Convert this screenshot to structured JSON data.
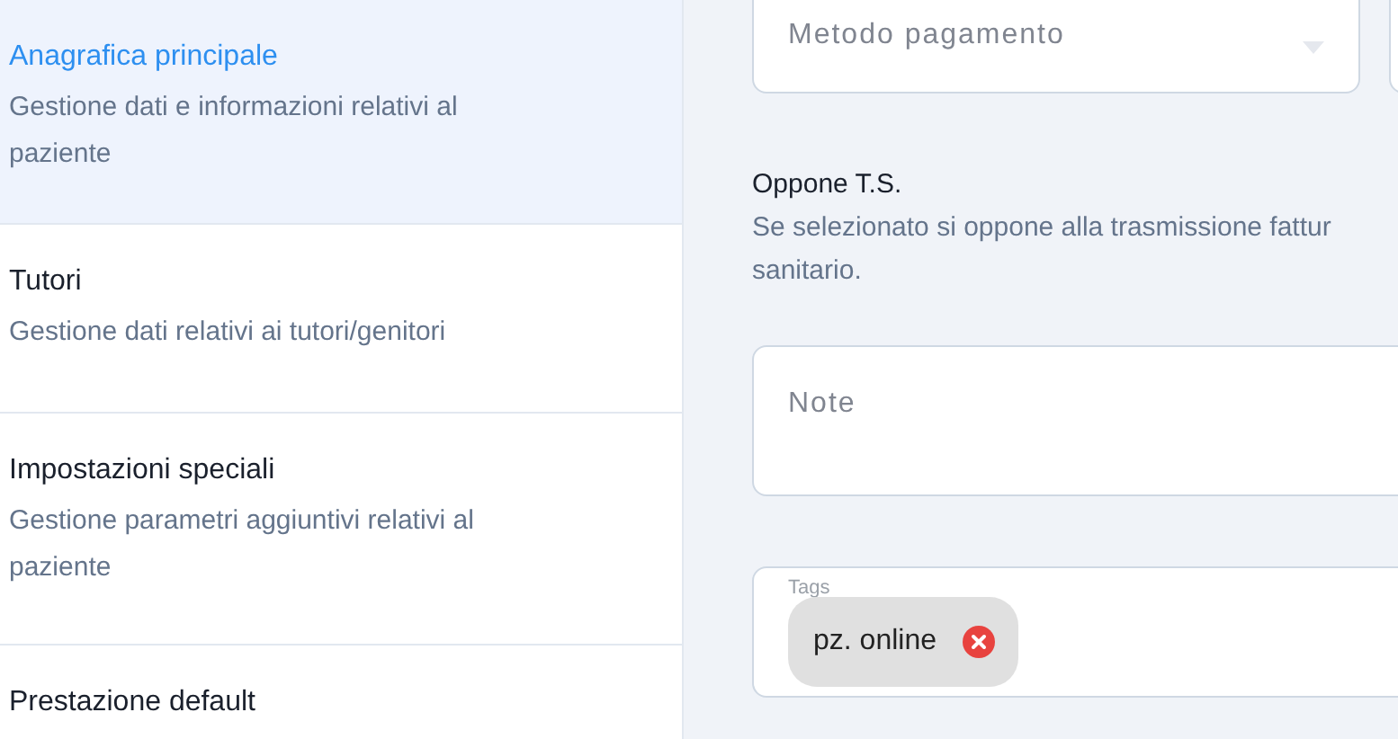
{
  "sidebar": {
    "items": [
      {
        "title": "Anagrafica principale",
        "description": "Gestione dati e informazioni relativi al paziente",
        "selected": true
      },
      {
        "title": "Tutori",
        "description": "Gestione dati relativi ai tutori/genitori",
        "selected": false
      },
      {
        "title": "Impostazioni speciali",
        "description": "Gestione parametri aggiuntivi relativi al paziente",
        "selected": false
      },
      {
        "title": "Prestazione default",
        "selected": false
      }
    ]
  },
  "form": {
    "payment_method": {
      "placeholder": "Metodo pagamento"
    },
    "oppone_ts": {
      "label": "Oppone T.S.",
      "description_lines": [
        "Se selezionato si oppone alla trasmissione fattur",
        "sanitario."
      ]
    },
    "note": {
      "placeholder": "Note"
    },
    "tags": {
      "label": "Tags",
      "chips": [
        "pz. online"
      ]
    }
  }
}
